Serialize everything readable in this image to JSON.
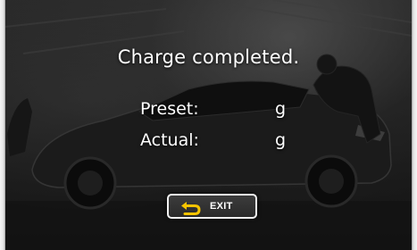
{
  "dialog": {
    "title": "Charge completed.",
    "preset": {
      "label": "Preset:",
      "value": "",
      "unit": "g"
    },
    "actual": {
      "label": "Actual:",
      "value": "",
      "unit": "g"
    }
  },
  "exit_button": {
    "label": "EXIT",
    "icon": "return-arrow-icon",
    "icon_color": "#f5c400"
  },
  "background": {
    "description_colors": {
      "dark": "#1c1c1c",
      "mid": "#3a3a3a"
    }
  }
}
